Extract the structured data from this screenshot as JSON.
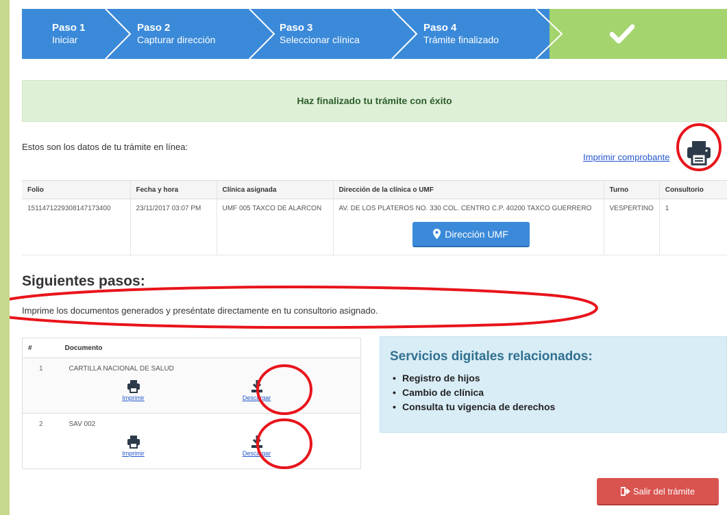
{
  "steps": [
    {
      "num": "Paso 1",
      "label": "Iniciar"
    },
    {
      "num": "Paso 2",
      "label": "Capturar dirección"
    },
    {
      "num": "Paso 3",
      "label": "Seleccionar clínica"
    },
    {
      "num": "Paso 4",
      "label": "Trámite finalizado"
    }
  ],
  "success_message": "Haz finalizado tu trámite con éxito",
  "intro_text": "Estos son los datos de tu trámite en línea:",
  "print_receipt_label": "Imprimir comprobante",
  "details_table": {
    "headers": [
      "Folio",
      "Fecha y hora",
      "Clínica asignada",
      "Dirección de la clínica o UMF",
      "Turno",
      "Consultorio"
    ],
    "row": {
      "folio": "151147122930814717340​0",
      "datetime": "23/11/2017 03:07 PM",
      "clinic": "UMF 005 TAXCO DE ALARCON",
      "address": "AV. DE LOS PLATEROS NO. 330 COL. CENTRO C.P. 40200 TAXCO GUERRERO",
      "shift": "VESPERTINO",
      "office": "1"
    },
    "umf_button_label": "Dirección UMF"
  },
  "next_steps": {
    "title": "Siguientes pasos:",
    "text": "Imprime los documentos generados y preséntate directamente en tu consultorio asignado."
  },
  "documents_table": {
    "headers": [
      "#",
      "Documento"
    ],
    "rows": [
      {
        "idx": "1",
        "name": "CARTILLA NACIONAL DE SALUD",
        "print_label": "Imprimir",
        "download_label": "Descargar"
      },
      {
        "idx": "2",
        "name": "SAV 002",
        "print_label": "Imprimir",
        "download_label": "Descargar"
      }
    ]
  },
  "services": {
    "title": "Servicios digitales relacionados:",
    "items": [
      "Registro de hijos",
      "Cambio de clínica",
      "Consulta tu vigencia de derechos"
    ]
  },
  "exit_button_label": "Salir del trámite",
  "colors": {
    "step_blue": "#3b8ad9",
    "step_done": "#a4d46e",
    "success_bg": "#dff0d8",
    "info_bg": "#d9edf7",
    "danger": "#d9534f",
    "annotation": "#e8141b"
  }
}
